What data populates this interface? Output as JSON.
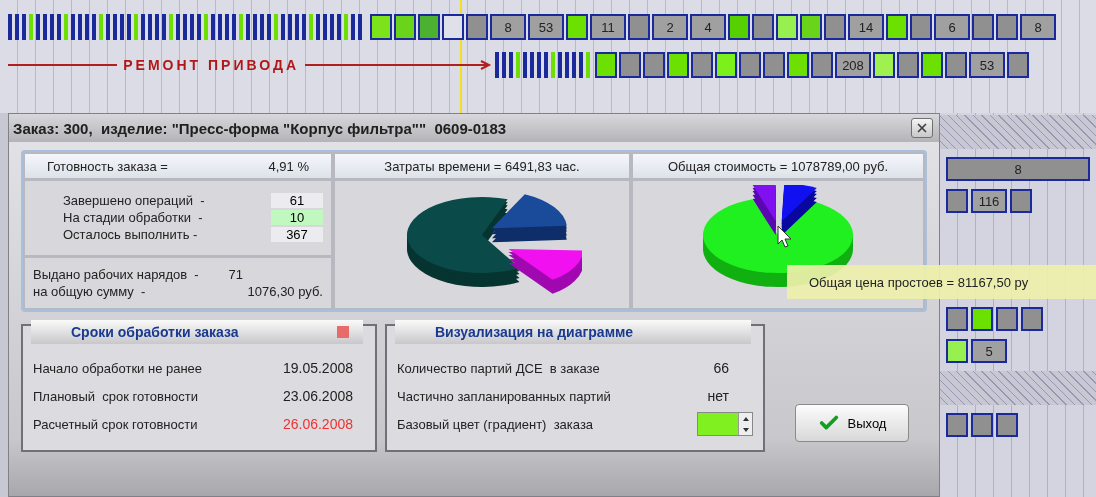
{
  "gantt": {
    "rows": [
      {
        "bars": [
          {
            "kind": "stripes",
            "color": "#1a2a9a"
          },
          {
            "kind": "bar",
            "color": "#7ce21a"
          },
          {
            "kind": "bar",
            "color": "#6ad41a"
          },
          {
            "kind": "bar",
            "color": "#4cb030"
          },
          {
            "kind": "bar",
            "color": "#e0e0e8"
          },
          {
            "kind": "bar",
            "color": "#909090"
          },
          {
            "kind": "bar",
            "color": "#a0a0a0",
            "text": "8"
          },
          {
            "kind": "bar",
            "color": "#a0a0a0",
            "text": "53"
          },
          {
            "kind": "bar",
            "color": "#6ce000"
          },
          {
            "kind": "bar",
            "color": "#a0a0a0",
            "text": "11"
          },
          {
            "kind": "bar",
            "color": "#909090"
          },
          {
            "kind": "bar",
            "color": "#a0a0a0",
            "text": "2"
          },
          {
            "kind": "bar",
            "color": "#a0a0a0",
            "text": "4"
          },
          {
            "kind": "bar",
            "color": "#56d000"
          },
          {
            "kind": "bar",
            "color": "#909090"
          },
          {
            "kind": "bar",
            "color": "#98f050"
          },
          {
            "kind": "bar",
            "color": "#6ad41a"
          },
          {
            "kind": "bar",
            "color": "#909090"
          },
          {
            "kind": "bar",
            "color": "#a0a0a0",
            "text": "14"
          },
          {
            "kind": "bar",
            "color": "#6ce000"
          },
          {
            "kind": "bar",
            "color": "#909090"
          },
          {
            "kind": "bar",
            "color": "#a0a0a0",
            "text": "6"
          },
          {
            "kind": "bar",
            "color": "#909090"
          },
          {
            "kind": "bar",
            "color": "#909090"
          },
          {
            "kind": "bar",
            "color": "#a0a0a0",
            "text": "8"
          }
        ]
      },
      {
        "label": "РЕМОНТ ПРИВОДА",
        "bars": [
          {
            "kind": "stripes",
            "color": "#1a2a9a"
          },
          {
            "kind": "bar",
            "color": "#6ce000"
          },
          {
            "kind": "bar",
            "color": "#909090"
          },
          {
            "kind": "bar",
            "color": "#909090"
          },
          {
            "kind": "bar",
            "color": "#6ce000"
          },
          {
            "kind": "bar",
            "color": "#909090"
          },
          {
            "kind": "bar",
            "color": "#7cf01a"
          },
          {
            "kind": "bar",
            "color": "#909090"
          },
          {
            "kind": "bar",
            "color": "#909090"
          },
          {
            "kind": "bar",
            "color": "#6ce000"
          },
          {
            "kind": "bar",
            "color": "#909090"
          },
          {
            "kind": "bar",
            "color": "#a0a0a0",
            "text": "208"
          },
          {
            "kind": "bar",
            "color": "#a0f050"
          },
          {
            "kind": "bar",
            "color": "#909090"
          },
          {
            "kind": "bar",
            "color": "#6ce000"
          },
          {
            "kind": "bar",
            "color": "#909090"
          },
          {
            "kind": "bar",
            "color": "#a0a0a0",
            "text": "53"
          },
          {
            "kind": "bar",
            "color": "#909090"
          }
        ]
      }
    ],
    "side_rows": [
      {
        "kind": "hatched"
      },
      {
        "kind": "bars",
        "bars": [
          {
            "color": "#909090",
            "text": "8"
          }
        ]
      },
      {
        "kind": "bars",
        "bars": [
          {
            "color": "#909090"
          },
          {
            "color": "#a0a0a0",
            "text": "116"
          },
          {
            "color": "#909090"
          }
        ]
      },
      {
        "kind": "blank"
      },
      {
        "kind": "bars",
        "bars": [
          {
            "color": "#909090"
          },
          {
            "color": "#6ce000"
          },
          {
            "color": "#909090"
          },
          {
            "color": "#909090"
          }
        ]
      },
      {
        "kind": "bars",
        "bars": [
          {
            "color": "#98f050"
          },
          {
            "color": "#a0a0a0",
            "text": "5"
          }
        ]
      },
      {
        "kind": "hatched"
      },
      {
        "kind": "bars",
        "bars": [
          {
            "color": "#909090"
          },
          {
            "color": "#909090"
          },
          {
            "color": "#909090"
          }
        ]
      }
    ]
  },
  "tooltip": "Общая цена простоев = 81167,50 ру",
  "dialog": {
    "title": "Заказ: 300,  изделие: \"Пресс-форма \"Корпус фильтра\"\"  0609-0183",
    "readiness": {
      "label": "Готовность заказа =",
      "value": "4,91 %"
    },
    "operations": [
      {
        "label": "Завершено операций  -",
        "value": "61",
        "highlight": false
      },
      {
        "label": "На стадии обработки  -",
        "value": "10",
        "highlight": true
      },
      {
        "label": "Осталось выполнить -",
        "value": "367",
        "highlight": false
      }
    ],
    "work_orders": [
      {
        "label": "Выдано рабочих нарядов  -",
        "value": "71"
      },
      {
        "label": "на общую сумму  -",
        "value": "1076,30 руб."
      }
    ],
    "time_chart": {
      "title": "Затраты времени = 6491,83 час."
    },
    "cost_chart": {
      "title": "Общая стоимость = 1078789,00 руб."
    },
    "schedule": {
      "title": "Сроки обработки заказа",
      "rows": [
        {
          "label": "Начало обработки не ранее",
          "value": "19.05.2008",
          "overdue": false
        },
        {
          "label": "Плановый  срок готовности",
          "value": "23.06.2008",
          "overdue": false
        },
        {
          "label": "Расчетный срок готовности",
          "value": "26.06.2008",
          "overdue": true
        }
      ]
    },
    "visualization": {
      "title": "Визуализация на диаграмме",
      "rows": [
        {
          "label": "Количество партий ДСЕ  в заказе",
          "value": "66"
        },
        {
          "label": "Частично запланированных партий",
          "value": "нет"
        }
      ],
      "color_label": "Базовый цвет (градиент)  заказа"
    },
    "exit_button": "Выход"
  }
}
